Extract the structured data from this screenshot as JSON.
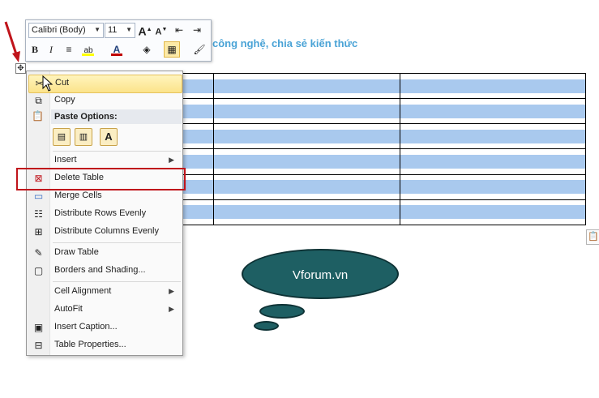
{
  "document": {
    "heading_fragment": "công nghệ, chia sẻ kiến thức"
  },
  "mini_toolbar": {
    "font_name": "Calibri (Body)",
    "font_size": "11",
    "grow_font_label": "A",
    "shrink_font_label": "A",
    "bold_label": "B",
    "italic_label": "I",
    "font_color_label": "A",
    "highlight_label": "ab"
  },
  "context_menu": {
    "items": [
      {
        "label": "Cut",
        "icon": "scissors-icon"
      },
      {
        "label": "Copy",
        "icon": "copy-icon"
      },
      {
        "label": "Paste Options:",
        "icon": "clipboard-icon"
      },
      {
        "label": "Insert",
        "icon": ""
      },
      {
        "label": "Delete Table",
        "icon": "delete-table-icon"
      },
      {
        "label": "Merge Cells",
        "icon": "merge-cells-icon"
      },
      {
        "label": "Distribute Rows Evenly",
        "icon": "distribute-rows-icon"
      },
      {
        "label": "Distribute Columns Evenly",
        "icon": "distribute-columns-icon"
      },
      {
        "label": "Draw Table",
        "icon": "draw-table-icon"
      },
      {
        "label": "Borders and Shading...",
        "icon": "borders-icon"
      },
      {
        "label": "Cell Alignment",
        "icon": ""
      },
      {
        "label": "AutoFit",
        "icon": ""
      },
      {
        "label": "Insert Caption...",
        "icon": "caption-icon"
      },
      {
        "label": "Table Properties...",
        "icon": "table-properties-icon"
      }
    ],
    "paste_text_only_label": "A",
    "highlighted_item": "Delete Table"
  },
  "bubble": {
    "text": "Vforum.vn"
  },
  "colors": {
    "accent_text": "#4aa3d6",
    "table_band": "#a9c9ee",
    "highlight_box": "#c0141b",
    "bubble_fill": "#1e5f63"
  }
}
